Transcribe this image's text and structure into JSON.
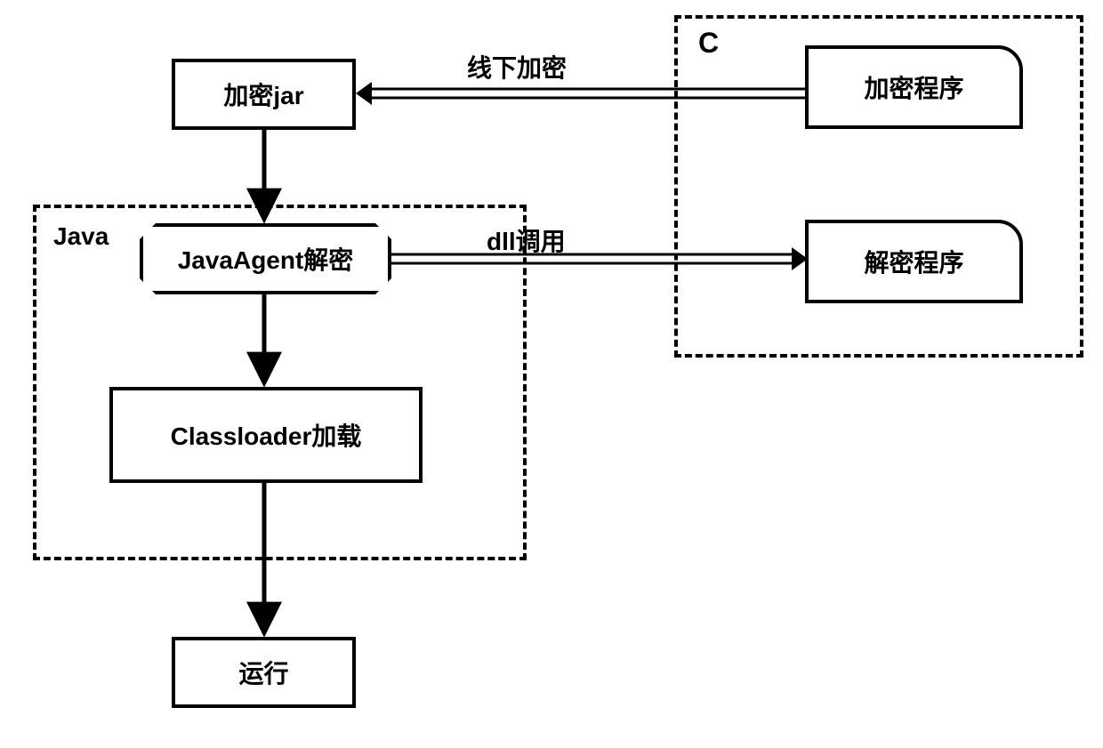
{
  "diagram": {
    "nodes": {
      "encrypt_jar": "加密jar",
      "java_agent_decrypt": "JavaAgent解密",
      "classloader_load": "Classloader加载",
      "run": "运行",
      "encrypt_program": "加密程序",
      "decrypt_program": "解密程序"
    },
    "containers": {
      "java": "Java",
      "c": "C"
    },
    "edges": {
      "offline_encrypt": "线下加密",
      "dll_call": "dll调用"
    }
  }
}
